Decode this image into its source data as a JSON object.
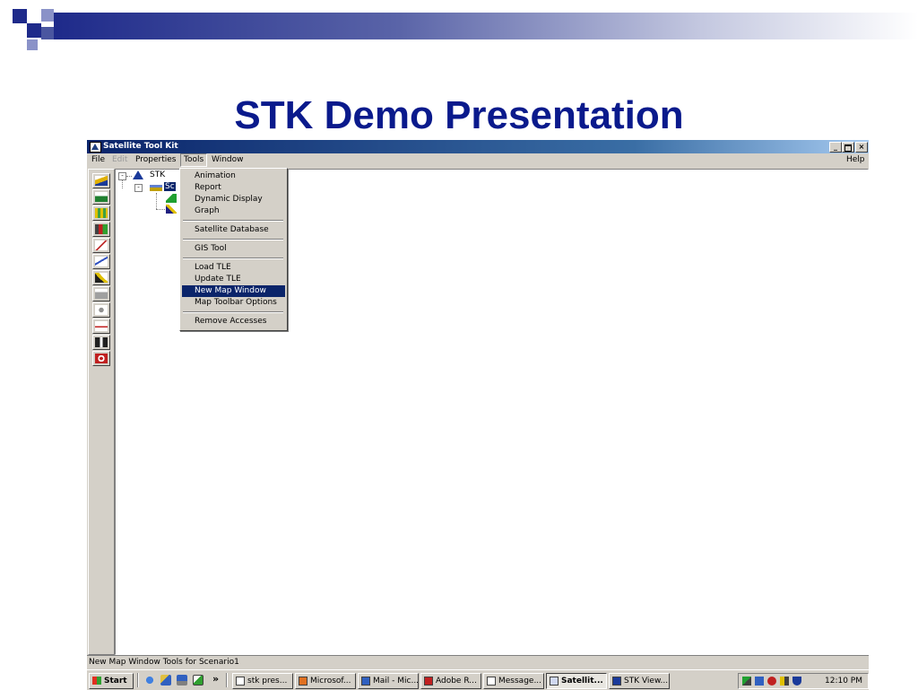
{
  "slide": {
    "title": "STK Demo Presentation"
  },
  "window": {
    "title": "Satellite Tool Kit",
    "caption_buttons": {
      "minimize": "_",
      "restore": "ř",
      "close": "×"
    }
  },
  "menubar": {
    "items": [
      {
        "label": "File",
        "enabled": true
      },
      {
        "label": "Edit",
        "enabled": false
      },
      {
        "label": "Properties",
        "enabled": true
      },
      {
        "label": "Tools",
        "enabled": true,
        "active": true
      },
      {
        "label": "Window",
        "enabled": true
      }
    ],
    "help": "Help"
  },
  "tree": {
    "root": "STK",
    "scenario": "Sc"
  },
  "tools_menu": {
    "groups": [
      [
        "Animation",
        "Report",
        "Dynamic Display",
        "Graph"
      ],
      [
        "Satellite Database"
      ],
      [
        "GIS Tool"
      ],
      [
        "Load TLE",
        "Update TLE",
        "New Map Window",
        "Map Toolbar Options"
      ],
      [
        "Remove Accesses"
      ]
    ],
    "highlighted": "New Map Window"
  },
  "statusbar": {
    "text": "New Map Window  Tools for Scenario1"
  },
  "taskbar": {
    "start_label": "Start",
    "quicklaunch_more": "»",
    "tasks": [
      {
        "label": "stk pres...",
        "pressed": false
      },
      {
        "label": "Microsof...",
        "pressed": false
      },
      {
        "label": "Mail - Mic...",
        "pressed": false
      },
      {
        "label": "Adobe R...",
        "pressed": false
      },
      {
        "label": "Message...",
        "pressed": false
      },
      {
        "label": "Satellit...",
        "pressed": true
      },
      {
        "label": "STK View...",
        "pressed": false
      }
    ],
    "clock": "12:10 PM"
  },
  "colors": {
    "slide_title": "#0a1a8c",
    "title_bar": "#0a246a",
    "menu_highlight": "#0a246a",
    "window_face": "#d4d0c8"
  }
}
